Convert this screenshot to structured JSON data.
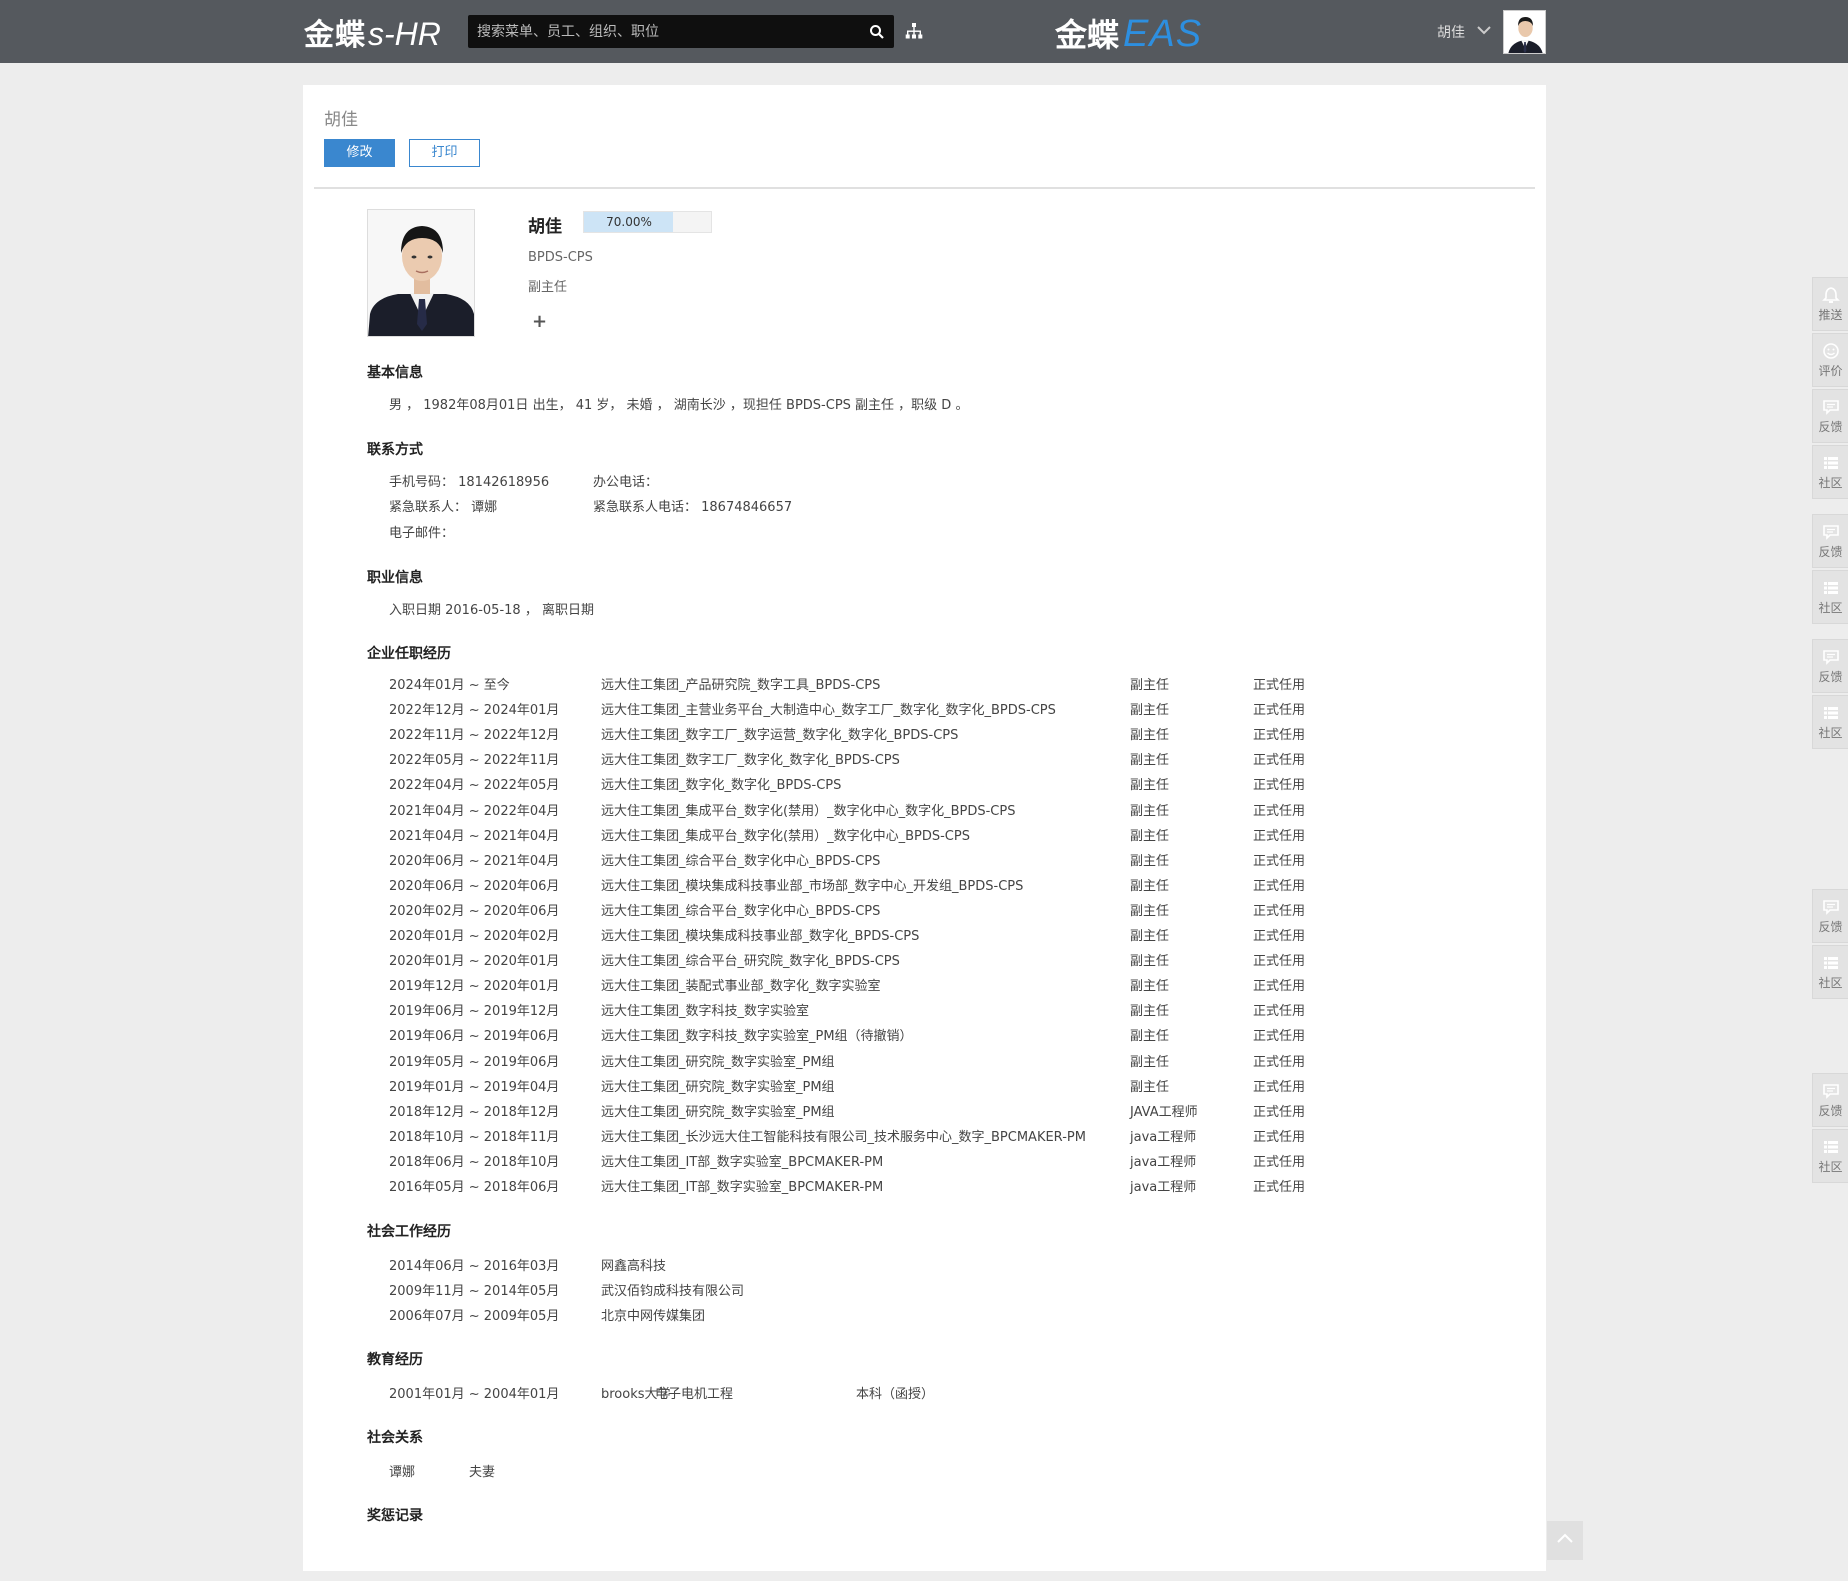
{
  "header": {
    "brand_cn": "金蝶",
    "brand_en": "s-HR",
    "search_placeholder": "搜索菜单、员工、组织、职位",
    "eas_cn": "金蝶",
    "eas_en": "EAS",
    "user_name": "胡佳"
  },
  "page": {
    "title": "胡佳",
    "edit_label": "修改",
    "print_label": "打印"
  },
  "profile": {
    "name": "胡佳",
    "completeness": "70.00%",
    "completeness_value": 0.7,
    "department": "BPDS-CPS",
    "position": "副主任",
    "add_symbol": "+"
  },
  "basic": {
    "heading": "基本信息",
    "text": "男 ， 1982年08月01日 出生， 41 岁， 未婚 ， 湖南长沙 ，现担任 BPDS-CPS 副主任 ，职级 D 。"
  },
  "contact": {
    "heading": "联系方式",
    "mobile": "手机号码： 18142618956",
    "office": "办公电话：",
    "emergency_contact": "紧急联系人： 谭娜",
    "emergency_phone": "紧急联系人电话： 18674846657",
    "email": "电子邮件："
  },
  "career": {
    "heading": "职业信息",
    "text": "入职日期 2016-05-18 ， 离职日期"
  },
  "enterprise": {
    "heading": "企业任职经历",
    "rows": [
      {
        "period": "2024年01月 ~ 至今",
        "org": "远大住工集团_产品研究院_数字工具_BPDS-CPS",
        "position": "副主任",
        "type": "正式任用"
      },
      {
        "period": "2022年12月 ~ 2024年01月",
        "org": "远大住工集团_主营业务平台_大制造中心_数字工厂_数字化_数字化_BPDS-CPS",
        "position": "副主任",
        "type": "正式任用"
      },
      {
        "period": "2022年11月 ~ 2022年12月",
        "org": "远大住工集团_数字工厂_数字运营_数字化_数字化_BPDS-CPS",
        "position": "副主任",
        "type": "正式任用"
      },
      {
        "period": "2022年05月 ~ 2022年11月",
        "org": "远大住工集团_数字工厂_数字化_数字化_BPDS-CPS",
        "position": "副主任",
        "type": "正式任用"
      },
      {
        "period": "2022年04月 ~ 2022年05月",
        "org": "远大住工集团_数字化_数字化_BPDS-CPS",
        "position": "副主任",
        "type": "正式任用"
      },
      {
        "period": "2021年04月 ~ 2022年04月",
        "org": "远大住工集团_集成平台_数字化(禁用）_数字化中心_数字化_BPDS-CPS",
        "position": "副主任",
        "type": "正式任用"
      },
      {
        "period": "2021年04月 ~ 2021年04月",
        "org": "远大住工集团_集成平台_数字化(禁用）_数字化中心_BPDS-CPS",
        "position": "副主任",
        "type": "正式任用"
      },
      {
        "period": "2020年06月 ~ 2021年04月",
        "org": "远大住工集团_综合平台_数字化中心_BPDS-CPS",
        "position": "副主任",
        "type": "正式任用"
      },
      {
        "period": "2020年06月 ~ 2020年06月",
        "org": "远大住工集团_模块集成科技事业部_市场部_数字中心_开发组_BPDS-CPS",
        "position": "副主任",
        "type": "正式任用"
      },
      {
        "period": "2020年02月 ~ 2020年06月",
        "org": "远大住工集团_综合平台_数字化中心_BPDS-CPS",
        "position": "副主任",
        "type": "正式任用"
      },
      {
        "period": "2020年01月 ~ 2020年02月",
        "org": "远大住工集团_模块集成科技事业部_数字化_BPDS-CPS",
        "position": "副主任",
        "type": "正式任用"
      },
      {
        "period": "2020年01月 ~ 2020年01月",
        "org": "远大住工集团_综合平台_研究院_数字化_BPDS-CPS",
        "position": "副主任",
        "type": "正式任用"
      },
      {
        "period": "2019年12月 ~ 2020年01月",
        "org": "远大住工集团_装配式事业部_数字化_数字实验室",
        "position": "副主任",
        "type": "正式任用"
      },
      {
        "period": "2019年06月 ~ 2019年12月",
        "org": "远大住工集团_数字科技_数字实验室",
        "position": "副主任",
        "type": "正式任用"
      },
      {
        "period": "2019年06月 ~ 2019年06月",
        "org": "远大住工集团_数字科技_数字实验室_PM组（待撤销）",
        "position": "副主任",
        "type": "正式任用"
      },
      {
        "period": "2019年05月 ~ 2019年06月",
        "org": "远大住工集团_研究院_数字实验室_PM组",
        "position": "副主任",
        "type": "正式任用"
      },
      {
        "period": "2019年01月 ~ 2019年04月",
        "org": "远大住工集团_研究院_数字实验室_PM组",
        "position": "副主任",
        "type": "正式任用"
      },
      {
        "period": "2018年12月 ~ 2018年12月",
        "org": "远大住工集团_研究院_数字实验室_PM组",
        "position": "JAVA工程师",
        "type": "正式任用"
      },
      {
        "period": "2018年10月 ~ 2018年11月",
        "org": "远大住工集团_长沙远大住工智能科技有限公司_技术服务中心_数字_BPCMAKER-PM",
        "position": "java工程师",
        "type": "正式任用"
      },
      {
        "period": "2018年06月 ~ 2018年10月",
        "org": "远大住工集团_IT部_数字实验室_BPCMAKER-PM",
        "position": "java工程师",
        "type": "正式任用"
      },
      {
        "period": "2016年05月 ~ 2018年06月",
        "org": "远大住工集团_IT部_数字实验室_BPCMAKER-PM",
        "position": "java工程师",
        "type": "正式任用"
      }
    ]
  },
  "social": {
    "heading": "社会工作经历",
    "rows": [
      {
        "period": "2014年06月 ~ 2016年03月",
        "company": "网鑫高科技"
      },
      {
        "period": "2009年11月 ~ 2014年05月",
        "company": "武汉佰钧成科技有限公司"
      },
      {
        "period": "2006年07月 ~ 2009年05月",
        "company": "北京中网传媒集团"
      }
    ]
  },
  "education": {
    "heading": "教育经历",
    "rows": [
      {
        "period": "2001年01月 ~ 2004年01月",
        "school": "brooks大学",
        "major": "电子电机工程",
        "degree": "本科（函授）"
      }
    ]
  },
  "relations": {
    "heading": "社会关系",
    "name": "谭娜",
    "relation": "夫妻"
  },
  "awards": {
    "heading": "奖惩记录"
  },
  "sidebar": {
    "push": "推送",
    "rate": "评价",
    "feedback": "反馈",
    "community": "社区"
  }
}
